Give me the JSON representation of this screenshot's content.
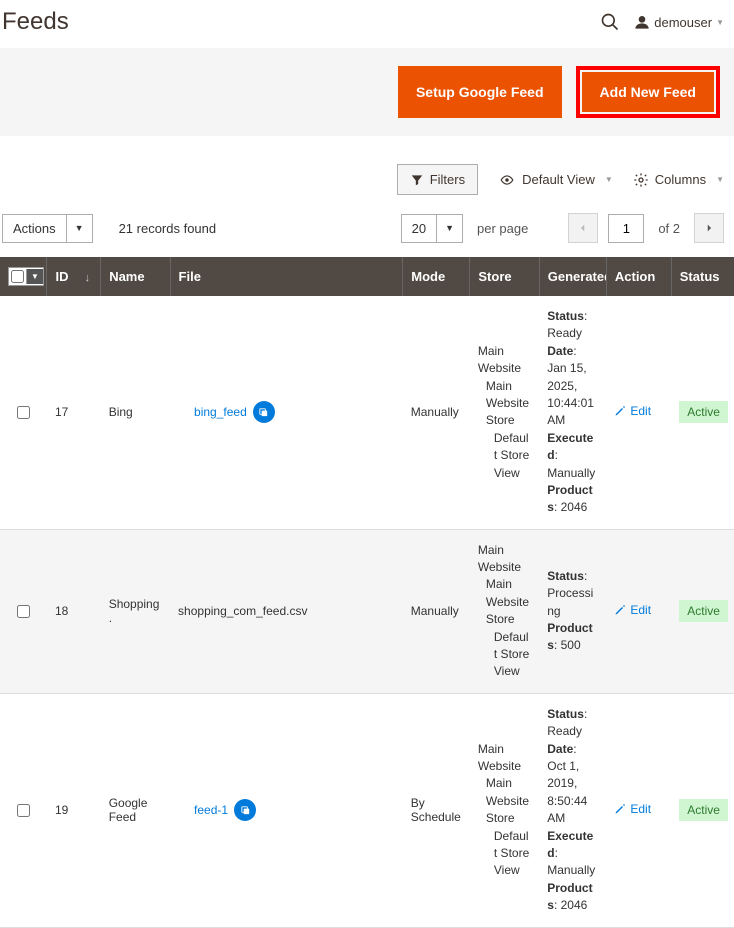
{
  "header": {
    "title": "Feeds",
    "username": "demouser"
  },
  "actions": {
    "setup_google": "Setup Google Feed",
    "add_new": "Add New Feed"
  },
  "toolbar": {
    "filters": "Filters",
    "default_view": "Default View",
    "columns": "Columns"
  },
  "controls": {
    "actions_label": "Actions",
    "records_found": "21 records found",
    "page_size": "20",
    "per_page": "per page",
    "current_page": "1",
    "of_pages": "of 2"
  },
  "columns": {
    "id": "ID",
    "name": "Name",
    "file": "File",
    "mode": "Mode",
    "store": "Store",
    "generated": "Generated",
    "action": "Action",
    "status": "Status"
  },
  "store_label": {
    "l1": "Main Website",
    "l2": "Main Website Store",
    "l3": "Default Store View"
  },
  "action_edit": "Edit",
  "status_active": "Active",
  "rows": [
    {
      "id": "17",
      "name": "Bing",
      "file_label": "bing_feed",
      "file_is_link": true,
      "mode": "Manually",
      "gen": {
        "status_k": "Status",
        "status_v": ": Ready",
        "date_k": "Date",
        "date_v": ": Jan 15, 2025, 10:44:01 AM",
        "exec_k": "Executed",
        "exec_v": ": Manually",
        "prod_k": "Products",
        "prod_v": ": 2046"
      }
    },
    {
      "id": "18",
      "name": "Shopping.",
      "file_label": "shopping_com_feed.csv",
      "file_is_link": false,
      "mode": "Manually",
      "gen": {
        "status_k": "Status",
        "status_v": ": Processing",
        "date_k": "",
        "date_v": "",
        "exec_k": "",
        "exec_v": "",
        "prod_k": "Products",
        "prod_v": ": 500"
      }
    },
    {
      "id": "19",
      "name": "Google Feed",
      "file_label": "feed-1",
      "file_is_link": true,
      "mode": "By Schedule",
      "gen": {
        "status_k": "Status",
        "status_v": ": Ready",
        "date_k": "Date",
        "date_v": ": Oct 1, 2019, 8:50:44 AM",
        "exec_k": "Executed",
        "exec_v": ": Manually",
        "prod_k": "Products",
        "prod_v": ": 2046"
      }
    }
  ]
}
